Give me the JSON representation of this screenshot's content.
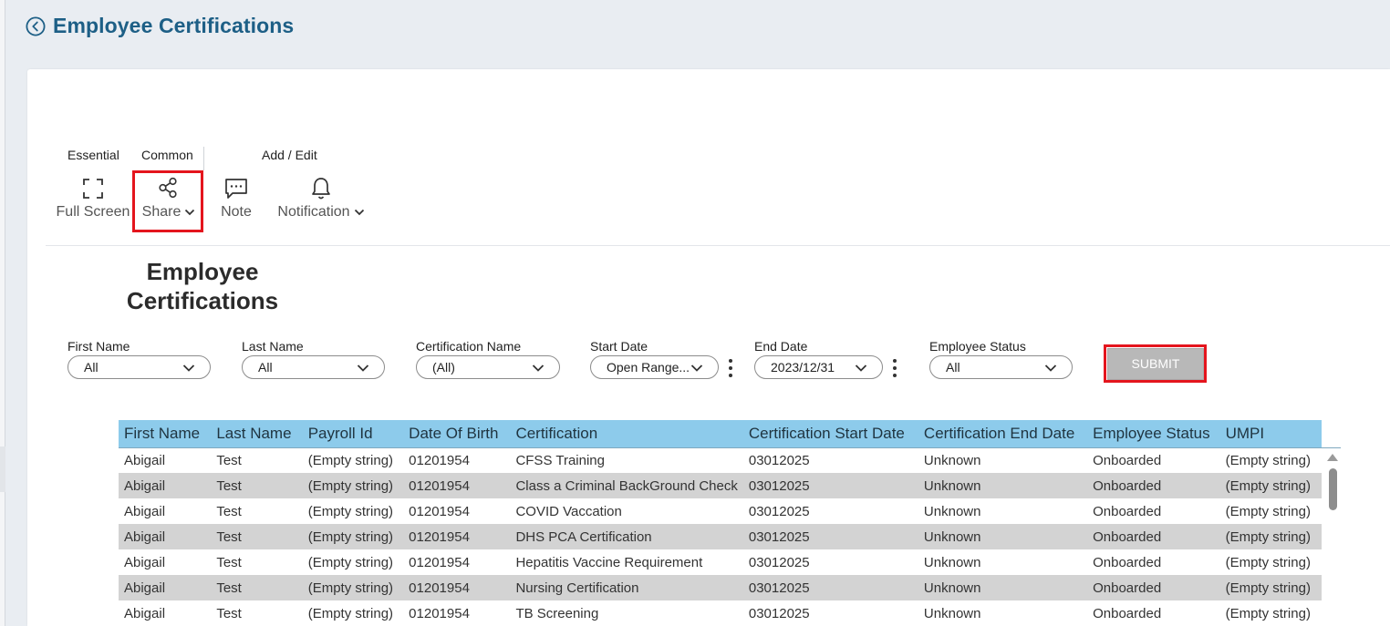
{
  "page": {
    "title": "Employee Certifications"
  },
  "toolbar": {
    "groups": {
      "essential": "Essential",
      "common": "Common",
      "add_edit": "Add / Edit"
    },
    "full_screen": "Full Screen",
    "share": "Share",
    "note": "Note",
    "notification": "Notification"
  },
  "report": {
    "title_line1": "Employee",
    "title_line2": "Certifications"
  },
  "filters": {
    "first_name": {
      "label": "First Name",
      "value": "All"
    },
    "last_name": {
      "label": "Last Name",
      "value": "All"
    },
    "certification_name": {
      "label": "Certification Name",
      "value": "(All)"
    },
    "start_date": {
      "label": "Start Date",
      "value": "Open Range..."
    },
    "end_date": {
      "label": "End Date",
      "value": "2023/12/31"
    },
    "employee_status": {
      "label": "Employee Status",
      "value": "All"
    },
    "submit_label": "SUBMIT"
  },
  "table": {
    "headers": [
      "First Name",
      "Last Name",
      "Payroll Id",
      "Date Of Birth",
      "Certification",
      "Certification Start Date",
      "Certification End Date",
      "Employee Status",
      "UMPI"
    ],
    "rows": [
      [
        "Abigail",
        "Test",
        "(Empty string)",
        "01201954",
        "CFSS Training",
        "03012025",
        "Unknown",
        "Onboarded",
        "(Empty string)"
      ],
      [
        "Abigail",
        "Test",
        "(Empty string)",
        "01201954",
        "Class a Criminal BackGround Check",
        "03012025",
        "Unknown",
        "Onboarded",
        "(Empty string)"
      ],
      [
        "Abigail",
        "Test",
        "(Empty string)",
        "01201954",
        "COVID Vaccation",
        "03012025",
        "Unknown",
        "Onboarded",
        "(Empty string)"
      ],
      [
        "Abigail",
        "Test",
        "(Empty string)",
        "01201954",
        "DHS PCA Certification",
        "03012025",
        "Unknown",
        "Onboarded",
        "(Empty string)"
      ],
      [
        "Abigail",
        "Test",
        "(Empty string)",
        "01201954",
        "Hepatitis Vaccine Requirement",
        "03012025",
        "Unknown",
        "Onboarded",
        "(Empty string)"
      ],
      [
        "Abigail",
        "Test",
        "(Empty string)",
        "01201954",
        "Nursing Certification",
        "03012025",
        "Unknown",
        "Onboarded",
        "(Empty string)"
      ],
      [
        "Abigail",
        "Test",
        "(Empty string)",
        "01201954",
        "TB Screening",
        "03012025",
        "Unknown",
        "Onboarded",
        "(Empty string)"
      ]
    ]
  },
  "icons": {
    "back": "chevron-left-circle-icon",
    "full_screen": "fullscreen-icon",
    "share": "share-icon",
    "note": "note-icon",
    "notification": "bell-icon"
  },
  "colors": {
    "title": "#1d5f86",
    "table_header": "#8dcbeb",
    "row_alt": "#d3d3d3",
    "highlight": "#e4151d",
    "submit_bg": "#b8b8b8"
  }
}
